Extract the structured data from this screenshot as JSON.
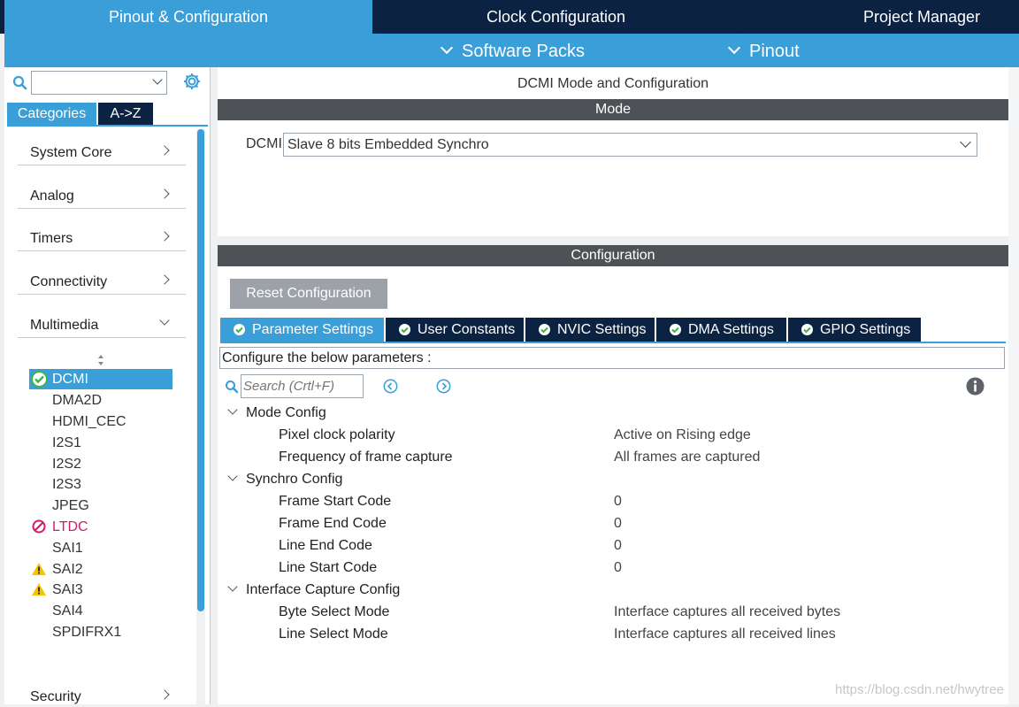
{
  "top_tabs": [
    "Pinout & Configuration",
    "Clock Configuration",
    "Project Manager"
  ],
  "sub_menu": [
    "Software Packs",
    "Pinout"
  ],
  "left": {
    "search_value": "",
    "category_tabs": [
      "Categories",
      "A->Z"
    ],
    "categories": [
      "System Core",
      "Analog",
      "Timers",
      "Connectivity",
      "Multimedia",
      "Security"
    ],
    "peripherals": [
      {
        "name": "DCMI",
        "status": "ok",
        "selected": true
      },
      {
        "name": "DMA2D",
        "status": "none"
      },
      {
        "name": "HDMI_CEC",
        "status": "none"
      },
      {
        "name": "I2S1",
        "status": "none"
      },
      {
        "name": "I2S2",
        "status": "none"
      },
      {
        "name": "I2S3",
        "status": "none"
      },
      {
        "name": "JPEG",
        "status": "none"
      },
      {
        "name": "LTDC",
        "status": "error"
      },
      {
        "name": "SAI1",
        "status": "none"
      },
      {
        "name": "SAI2",
        "status": "warning"
      },
      {
        "name": "SAI3",
        "status": "warning"
      },
      {
        "name": "SAI4",
        "status": "none"
      },
      {
        "name": "SPDIFRX1",
        "status": "none"
      }
    ]
  },
  "mode": {
    "title": "DCMI Mode and Configuration",
    "header": "Mode",
    "dcmi_label": "DCMI",
    "dcmi_value": "Slave 8 bits Embedded Synchro"
  },
  "config": {
    "header": "Configuration",
    "reset_label": "Reset Configuration",
    "tabs": [
      "Parameter Settings",
      "User Constants",
      "NVIC Settings",
      "DMA Settings",
      "GPIO Settings"
    ],
    "hint": "Configure the below parameters :",
    "search_placeholder": "Search (Crtl+F)",
    "groups": [
      {
        "name": "Mode Config",
        "params": [
          {
            "name": "Pixel clock polarity",
            "value": "Active on Rising edge"
          },
          {
            "name": "Frequency of frame capture",
            "value": "All frames are captured"
          }
        ]
      },
      {
        "name": "Synchro Config",
        "params": [
          {
            "name": "Frame Start Code",
            "value": "0"
          },
          {
            "name": "Frame End Code",
            "value": "0"
          },
          {
            "name": "Line End Code",
            "value": "0"
          },
          {
            "name": "Line Start Code",
            "value": "0"
          }
        ]
      },
      {
        "name": "Interface Capture Config",
        "params": [
          {
            "name": "Byte Select Mode",
            "value": "Interface captures all received bytes"
          },
          {
            "name": "Line Select Mode",
            "value": "Interface captures all received lines"
          }
        ]
      }
    ]
  },
  "watermark": "https://blog.csdn.net/hwytree",
  "colors": {
    "accent": "#3a9ed8",
    "dark": "#0b2243",
    "header": "#4e5256",
    "error": "#d6196b",
    "warning": "#f5c400",
    "ok": "#3cb44b"
  }
}
